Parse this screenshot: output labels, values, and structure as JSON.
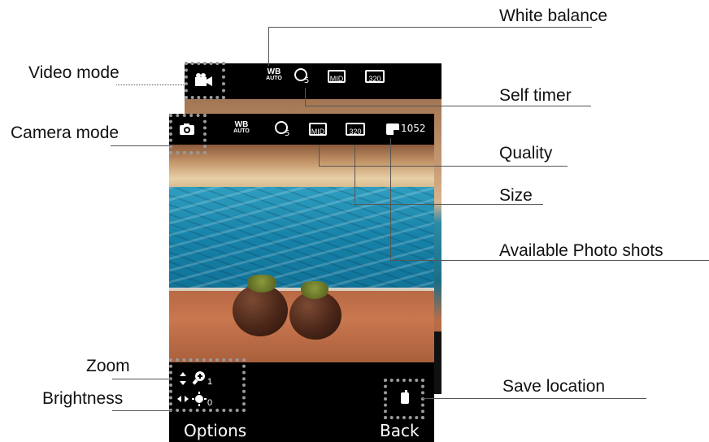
{
  "callouts": {
    "white_balance": "White balance",
    "video_mode": "Video mode",
    "self_timer": "Self timer",
    "camera_mode": "Camera mode",
    "quality": "Quality",
    "size": "Size",
    "available_photo_shots": "Available Photo shots",
    "zoom": "Zoom",
    "brightness": "Brightness",
    "save_location": "Save location"
  },
  "video_screen": {
    "wb_top": "WB",
    "wb_bottom": "AUTO",
    "timer_value": "5",
    "quality_value": "MID",
    "size_value": "320",
    "mode_icon": "video-camera-icon"
  },
  "camera_screen": {
    "wb_top": "WB",
    "wb_bottom": "AUTO",
    "timer_value": "5",
    "quality_value": "MID",
    "size_value": "320",
    "shots_count": "1052",
    "mode_icon": "camera-icon",
    "zoom_value": "1",
    "brightness_value": "0",
    "save_icon": "phone-memory-icon"
  },
  "softkeys": {
    "left": "Options",
    "right": "Back"
  },
  "colors": {
    "leader_line": "#555555",
    "dotted_frame": "#9a9a9a",
    "screen_bar": "#000000"
  }
}
